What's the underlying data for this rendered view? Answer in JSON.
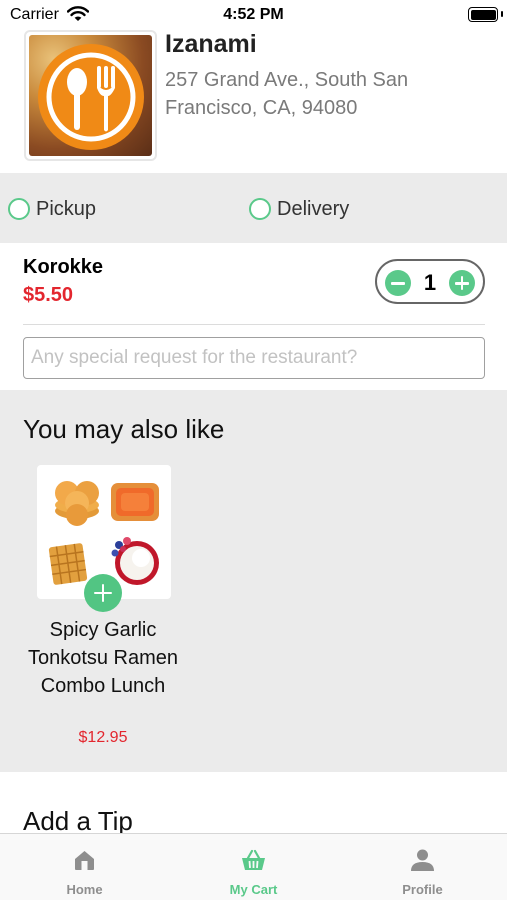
{
  "status_bar": {
    "carrier": "Carrier",
    "time": "4:52 PM",
    "wifi_icon": "wifi-icon",
    "battery_icon": "battery-icon"
  },
  "restaurant": {
    "name": "Izanami",
    "address": "257 Grand Ave., South San Francisco, CA, 94080",
    "logo_icon": "spoon-fork-icon"
  },
  "order_type": {
    "options": [
      {
        "label": "Pickup",
        "selected": false
      },
      {
        "label": "Delivery",
        "selected": false
      }
    ]
  },
  "cart_item": {
    "name": "Korokke",
    "price": "$5.50",
    "quantity": "1"
  },
  "special_request": {
    "placeholder": "Any special request for the restaurant?",
    "value": ""
  },
  "suggestions": {
    "title": "You may also like",
    "items": [
      {
        "name": "Spicy Garlic Tonkotsu Ramen Combo Lunch",
        "price": "$12.95"
      }
    ]
  },
  "tip": {
    "title": "Add a Tip"
  },
  "tab_bar": {
    "tabs": [
      {
        "label": "Home",
        "icon": "home-icon",
        "active": false
      },
      {
        "label": "My Cart",
        "icon": "basket-icon",
        "active": true
      },
      {
        "label": "Profile",
        "icon": "person-icon",
        "active": false
      }
    ]
  },
  "colors": {
    "accent_green": "#5ac98a",
    "price_red": "#e3262e",
    "logo_orange": "#f08a16",
    "section_gray": "#ebebeb"
  }
}
